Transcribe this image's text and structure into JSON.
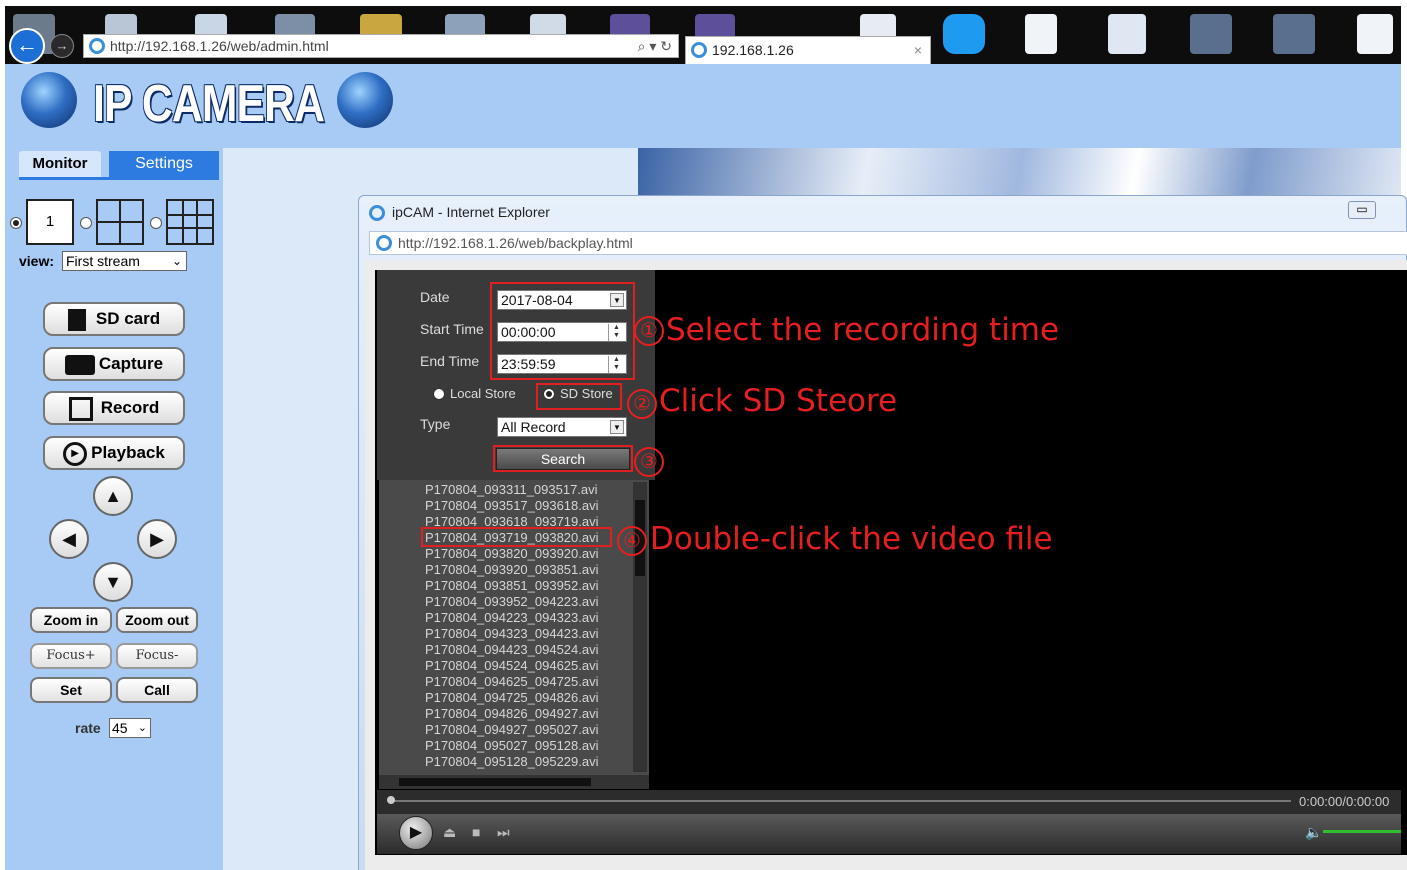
{
  "browser": {
    "address_url": "http://192.168.1.26/web/admin.html",
    "address_controls": "⌕ ▾ ↻",
    "tab_title": "192.168.1.26",
    "tab_close": "×",
    "colors": {
      "chrome": "#0d0d0d",
      "back_button": "#1d6fd6"
    }
  },
  "header": {
    "logo_text": "IP CAMERA",
    "bg_color": "#a7cbf5"
  },
  "sidebar": {
    "tabs": {
      "monitor": "Monitor",
      "settings": "Settings"
    },
    "layout_options": {
      "single_label": "1"
    },
    "view_label": "view:",
    "view_select": "First stream",
    "buttons": {
      "sd_card": "SD card",
      "capture": "Capture",
      "record": "Record",
      "playback": "Playback"
    },
    "ptz": {
      "up": "▲",
      "left": "◀",
      "right": "▶",
      "down": "▼"
    },
    "small_buttons": {
      "zoom_in": "Zoom in",
      "zoom_out": "Zoom out",
      "focus_plus": "Focus+",
      "focus_minus": "Focus-",
      "set": "Set",
      "call": "Call"
    },
    "rate_label": "rate",
    "rate_value": "45"
  },
  "popup": {
    "title": "ipCAM - Internet Explorer",
    "address_url": "http://192.168.1.26/web/backplay.html",
    "minimize": "▭",
    "form": {
      "date_label": "Date",
      "date_value": "2017-08-04",
      "start_label": "Start Time",
      "start_value": "00:00:00",
      "end_label": "End Time",
      "end_value": "23:59:59",
      "local_store": "Local Store",
      "sd_store": "SD Store",
      "type_label": "Type",
      "type_value": "All Record",
      "search": "Search"
    },
    "files": [
      "P170804_093311_093517.avi",
      "P170804_093517_093618.avi",
      "P170804_093618_093719.avi",
      "P170804_093719_093820.avi",
      "P170804_093820_093920.avi",
      "P170804_093920_093851.avi",
      "P170804_093851_093952.avi",
      "P170804_093952_094223.avi",
      "P170804_094223_094323.avi",
      "P170804_094323_094423.avi",
      "P170804_094423_094524.avi",
      "P170804_094524_094625.avi",
      "P170804_094625_094725.avi",
      "P170804_094725_094826.avi",
      "P170804_094826_094927.avi",
      "P170804_094927_095027.avi",
      "P170804_095027_095128.avi",
      "P170804_095128_095229.avi"
    ],
    "time_readout": "0:00:00/0:00:00",
    "controls": {
      "play": "▶",
      "eject": "⏏",
      "stop": "■",
      "next": "⏭",
      "volume": "🔈"
    }
  },
  "annotations": {
    "step1_num": "①",
    "step1_text": "Select the recording time",
    "step2_num": "②",
    "step2_text": "Click SD Steore",
    "step3_num": "③",
    "step4_num": "④",
    "step4_text": "Double-click the video file",
    "color": "#e51f1f"
  }
}
